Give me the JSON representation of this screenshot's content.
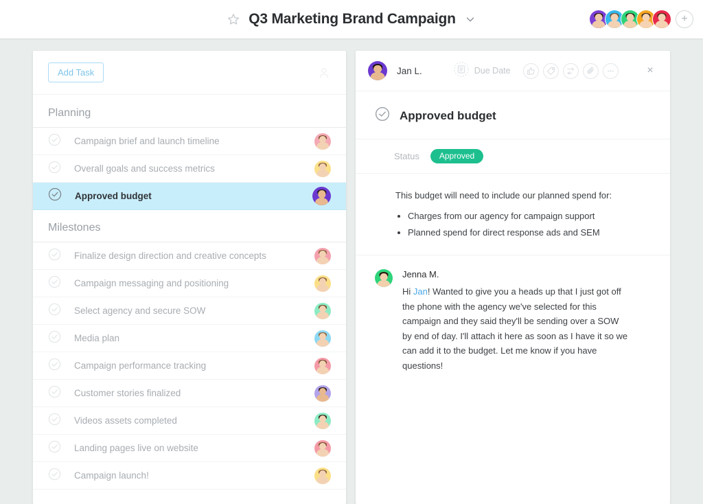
{
  "topbar": {
    "star_icon": "star-outline-icon",
    "title": "Q3 Marketing Brand Campaign",
    "chevron_icon": "chevron-down-icon",
    "add_member_label": "+",
    "members": [
      {
        "name": "member-1",
        "bg": "#7b3fd4",
        "skin": "#f0c9a8",
        "hair": "#241a12"
      },
      {
        "name": "member-2",
        "bg": "#35b8ec",
        "skin": "#f3d2b4",
        "hair": "#6b4a2c"
      },
      {
        "name": "member-3",
        "bg": "#2ed47a",
        "skin": "#f2cfad",
        "hair": "#2a1c12"
      },
      {
        "name": "member-4",
        "bg": "#f5a623",
        "skin": "#f5d3b3",
        "hair": "#3a2415"
      },
      {
        "name": "member-5",
        "bg": "#e8294a",
        "skin": "#f4d1b2",
        "hair": "#4a2a18"
      }
    ]
  },
  "task_list": {
    "add_task_label": "Add Task",
    "assignee_icon": "person-icon",
    "sections": [
      {
        "title": "Planning",
        "tasks": [
          {
            "label": "Campaign brief and launch timeline",
            "selected": false,
            "avatar": {
              "bg": "#f4a9b4",
              "skin": "#f3d2b4",
              "hair": "#7a5032"
            }
          },
          {
            "label": "Overall goals and success metrics",
            "selected": false,
            "avatar": {
              "bg": "#fbe08a",
              "skin": "#f3d2b4",
              "hair": "#8a6038"
            }
          },
          {
            "label": "Approved budget",
            "selected": true,
            "avatar": {
              "bg": "#6b39cf",
              "skin": "#e8b98f",
              "hair": "#1d1410"
            }
          }
        ]
      },
      {
        "title": "Milestones",
        "tasks": [
          {
            "label": "Finalize design direction and creative concepts",
            "selected": false,
            "avatar": {
              "bg": "#f4a0ad",
              "skin": "#f3d2b4",
              "hair": "#8a6038"
            }
          },
          {
            "label": "Campaign messaging and positioning",
            "selected": false,
            "avatar": {
              "bg": "#fbdf87",
              "skin": "#f3d2b4",
              "hair": "#8a6038"
            }
          },
          {
            "label": "Select agency and secure SOW",
            "selected": false,
            "avatar": {
              "bg": "#8cebc3",
              "skin": "#f3d2b4",
              "hair": "#6d4a2c"
            }
          },
          {
            "label": "Media plan",
            "selected": false,
            "avatar": {
              "bg": "#8cd8f2",
              "skin": "#f3d2b4",
              "hair": "#8a6038"
            }
          },
          {
            "label": "Campaign performance tracking",
            "selected": false,
            "avatar": {
              "bg": "#f49aa6",
              "skin": "#f3d2b4",
              "hair": "#7a5032"
            }
          },
          {
            "label": "Customer stories finalized",
            "selected": false,
            "avatar": {
              "bg": "#b2a3ea",
              "skin": "#e8b98f",
              "hair": "#241a12"
            }
          },
          {
            "label": "Videos assets completed",
            "selected": false,
            "avatar": {
              "bg": "#8cebc3",
              "skin": "#f3d2b4",
              "hair": "#2f2118"
            }
          },
          {
            "label": "Landing pages live on website",
            "selected": false,
            "avatar": {
              "bg": "#f49aa6",
              "skin": "#f3d2b4",
              "hair": "#7a5032"
            }
          },
          {
            "label": "Campaign launch!",
            "selected": false,
            "avatar": {
              "bg": "#fbdf87",
              "skin": "#f3d2b4",
              "hair": "#8a6038"
            }
          }
        ]
      }
    ]
  },
  "task_detail": {
    "owner_name": "Jan L.",
    "owner_avatar": {
      "bg": "#6b39cf",
      "skin": "#e8b98f",
      "hair": "#1d1410"
    },
    "due_date_label": "Due Date",
    "due_date_icon": "calendar-icon",
    "toolbar_icons": [
      {
        "name": "like-icon",
        "label": "Like"
      },
      {
        "name": "tag-icon",
        "label": "Tag"
      },
      {
        "name": "subtask-icon",
        "label": "Subtask"
      },
      {
        "name": "attachment-icon",
        "label": "Attach"
      },
      {
        "name": "more-icon",
        "label": "More"
      }
    ],
    "close_label": "×",
    "title": "Approved budget",
    "status_label": "Status",
    "status_value": "Approved",
    "status_color": "#1dbf8e",
    "description_lead": "This budget will need to include our planned spend for:",
    "description_bullets": [
      "Charges from our agency for campaign support",
      "Planned spend for direct response ads and SEM"
    ],
    "comment": {
      "author": "Jenna M.",
      "avatar": {
        "bg": "#2ed47a",
        "skin": "#f2cfad",
        "hair": "#2a1c12"
      },
      "text_before": "Hi ",
      "mention": "Jan",
      "text_after": "! Wanted to give you a heads up that I just got off the phone with the agency we've selected for this campaign and they said they'll be sending over a SOW by end of day. I'll attach it here as soon as I have it so we can add it to the budget. Let me know if you have questions!"
    }
  }
}
